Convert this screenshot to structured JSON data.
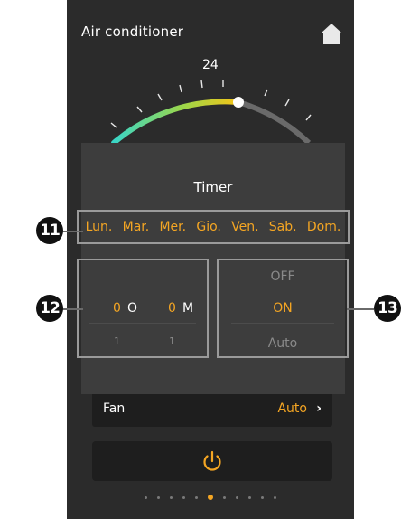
{
  "header": {
    "title": "Air conditioner",
    "home_icon": "home-icon"
  },
  "dial": {
    "setpoint": "24",
    "min_color": "#3ad6c7",
    "max_color": "#f5c518"
  },
  "timer": {
    "title": "Timer",
    "days": [
      "Lun.",
      "Mar.",
      "Mer.",
      "Gio.",
      "Ven.",
      "Sab.",
      "Dom."
    ],
    "hours_value": "0",
    "hours_label": "O",
    "minutes_value": "0",
    "minutes_label": "M",
    "hours_next": "1",
    "minutes_next": "1",
    "modes": [
      "OFF",
      "ON",
      "Auto"
    ],
    "selected_mode": "ON"
  },
  "fan": {
    "label": "Fan",
    "value": "Auto"
  },
  "power": {
    "icon": "power-icon"
  },
  "pager": {
    "total": 11,
    "active_index": 5
  },
  "callouts": {
    "days": "11",
    "time": "12",
    "mode": "13"
  },
  "colors": {
    "accent": "#f5a623",
    "background": "#2b2b2b",
    "panel": "#3d3d3d"
  }
}
